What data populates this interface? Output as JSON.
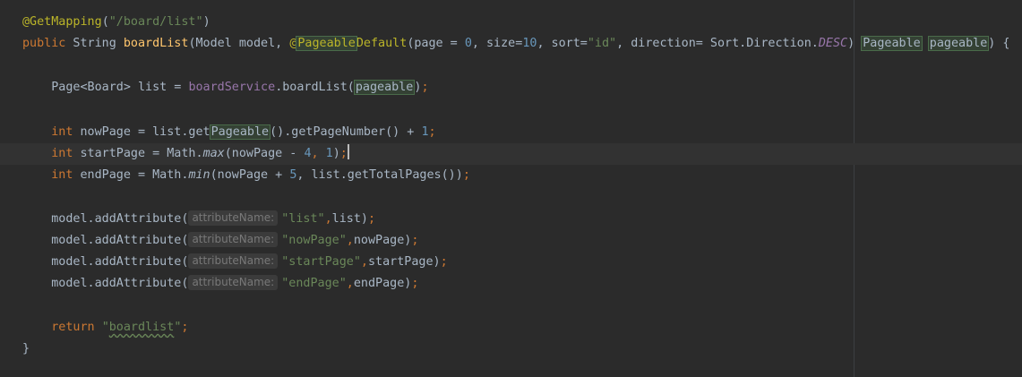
{
  "code": {
    "l1": {
      "ann": "@GetMapping",
      "p1": "(",
      "s1": "\"/board/list\"",
      "p2": ")"
    },
    "l2": {
      "kw_public": "public",
      "t1": " String ",
      "method": "boardList",
      "t2": "(Model model, ",
      "ann_at": "@",
      "ann_hl": "Pageable",
      "ann_rest": "Default",
      "t3": "(page = ",
      "n0": "0",
      "t4": ", size=",
      "n10": "10",
      "t5": ", sort=",
      "s_id": "\"id\"",
      "t6": ", direction= Sort.Direction.",
      "desc": "DESC",
      "t7": ") ",
      "type_hl": "Pageable",
      "t8": " ",
      "param_hl": "pageable",
      "t9": ") {"
    },
    "l4": {
      "t1": "    Page<Board> list = ",
      "field": "boardService",
      "t2": ".boardList(",
      "arg_hl": "pageable",
      "t3": ")",
      "semi": ";"
    },
    "l6": {
      "kw": "    int",
      "t1": " nowPage = list.get",
      "hl": "Pageable",
      "t2": "().getPageNumber() + ",
      "n1": "1",
      "semi": ";"
    },
    "l7": {
      "kw": "    int",
      "t1": " startPage = Math.",
      "fn": "max",
      "t2": "(nowPage - ",
      "n4": "4",
      "c": ", ",
      "n1": "1",
      "t3": ")",
      "semi": ";"
    },
    "l8": {
      "kw": "    int",
      "t1": " endPage = Math.",
      "fn": "min",
      "t2": "(nowPage + ",
      "n5": "5",
      "t3": ", list.getTotalPages())",
      "semi": ";"
    },
    "l10": {
      "t1": "    model.addAttribute(",
      "hint": "attributeName:",
      "s": "\"list\"",
      "c": ",",
      "t2": "list)",
      "semi": ";"
    },
    "l11": {
      "t1": "    model.addAttribute(",
      "hint": "attributeName:",
      "s": "\"nowPage\"",
      "c": ",",
      "t2": "nowPage)",
      "semi": ";"
    },
    "l12": {
      "t1": "    model.addAttribute(",
      "hint": "attributeName:",
      "s": "\"startPage\"",
      "c": ",",
      "t2": "startPage)",
      "semi": ";"
    },
    "l13": {
      "t1": "    model.addAttribute(",
      "hint": "attributeName:",
      "s": "\"endPage\"",
      "c": ",",
      "t2": "endPage)",
      "semi": ";"
    },
    "l15": {
      "kw": "    return",
      "sp": " ",
      "q1": "\"",
      "s": "boardlist",
      "q2": "\"",
      "semi": ";"
    },
    "l16": {
      "t1": "}"
    }
  }
}
